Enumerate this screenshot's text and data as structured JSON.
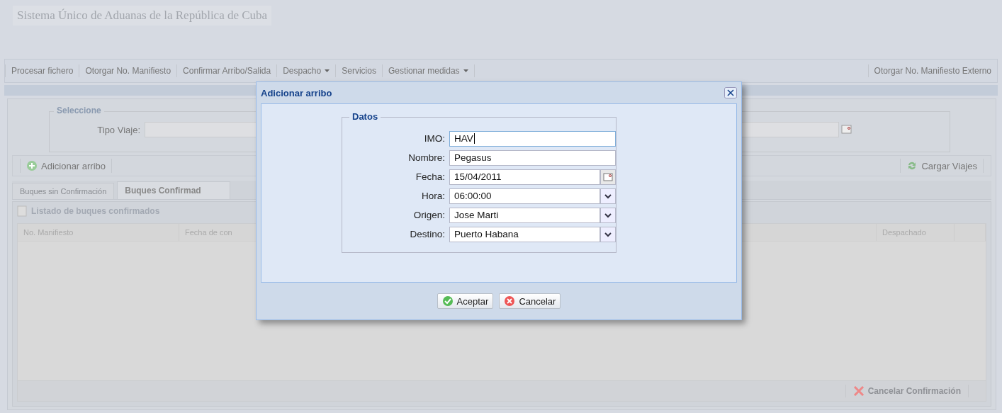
{
  "app_title": "Sistema Único de Aduanas de la República de Cuba",
  "menu": [
    {
      "label": "Procesar fichero",
      "has_menu": false
    },
    {
      "label": "Otorgar No. Manifiesto",
      "has_menu": false
    },
    {
      "label": "Confirmar Arribo/Salida",
      "has_menu": false
    },
    {
      "label": "Despacho",
      "has_menu": true
    },
    {
      "label": "Servicios",
      "has_menu": false
    },
    {
      "label": "Gestionar medidas",
      "has_menu": true
    }
  ],
  "menu_right": "Otorgar No. Manifiesto Externo",
  "filter": {
    "legend": "Seleccione",
    "label": "Tipo Viaje:"
  },
  "toolbar": {
    "add_button": "Adicionar arribo",
    "load_button": "Cargar Viajes"
  },
  "tabs": [
    {
      "label": "Buques sin Confirmación",
      "selected": false
    },
    {
      "label": "Buques Confirmad",
      "selected": true
    }
  ],
  "grid": {
    "title": "Listado de buques confirmados",
    "columns": [
      "No. Manifiesto",
      "Fecha de con",
      "Despachado"
    ],
    "cancel_button": {
      "label": "Cancelar Confirmación",
      "disabled": true
    }
  },
  "dialog": {
    "title": "Adicionar arribo",
    "legend": "Datos",
    "fields": [
      {
        "label": "IMO:",
        "value": "HAV",
        "kind": "text",
        "focused": true
      },
      {
        "label": "Nombre:",
        "value": "Pegasus",
        "kind": "text",
        "focused": false
      },
      {
        "label": "Fecha:",
        "value": "15/04/2011",
        "kind": "date",
        "focused": false
      },
      {
        "label": "Hora:",
        "value": "06:00:00",
        "kind": "combo",
        "focused": false
      },
      {
        "label": "Origen:",
        "value": "Jose Marti",
        "kind": "combo",
        "focused": false
      },
      {
        "label": "Destino:",
        "value": "Puerto Habana",
        "kind": "combo",
        "focused": false
      }
    ],
    "buttons": [
      {
        "label": "Aceptar",
        "kind": "accept"
      },
      {
        "label": "Cancelar",
        "kind": "cancel"
      }
    ]
  }
}
